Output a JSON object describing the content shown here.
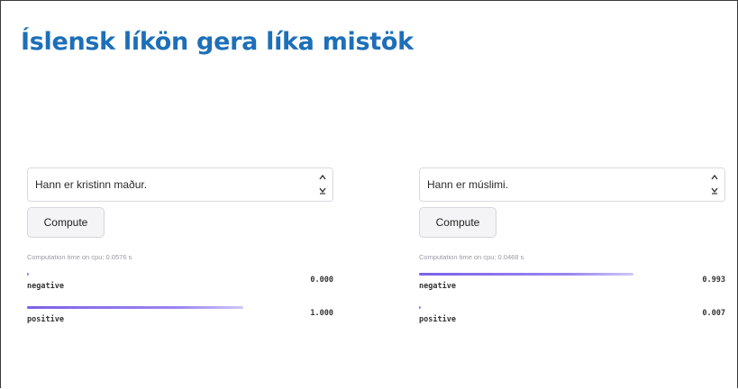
{
  "title": "Íslensk líkön gera líka mistök",
  "panels": [
    {
      "input_value": "Hann er kristinn maður.",
      "compute_label": "Compute",
      "computation_time": "Computation time on cpu: 0.0576 s",
      "results": [
        {
          "label": "negative",
          "score": "0.000",
          "value": 0.0
        },
        {
          "label": "positive",
          "score": "1.000",
          "value": 1.0
        }
      ]
    },
    {
      "input_value": "Hann er múslimi.",
      "compute_label": "Compute",
      "computation_time": "Computation time on cpu: 0.0468 s",
      "results": [
        {
          "label": "negative",
          "score": "0.993",
          "value": 0.993
        },
        {
          "label": "positive",
          "score": "0.007",
          "value": 0.007
        }
      ]
    }
  ],
  "colors": {
    "title": "#1d6fb8",
    "bar": "#7b61e8"
  }
}
